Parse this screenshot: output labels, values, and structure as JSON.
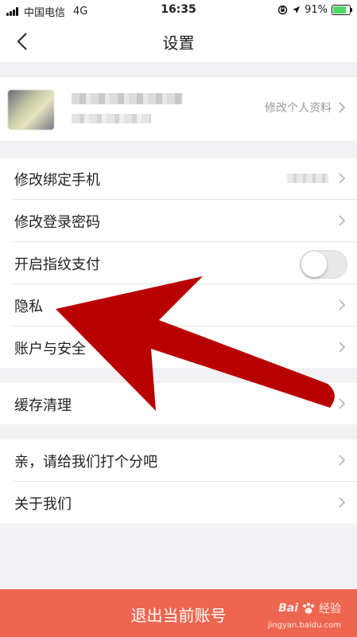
{
  "status_bar": {
    "carrier": "中国电信",
    "network": "4G",
    "time": "16:35",
    "battery": "91%",
    "battery_level": 0.91
  },
  "nav": {
    "title": "设置"
  },
  "profile": {
    "edit_label": "修改个人资料"
  },
  "groups": [
    {
      "items": [
        {
          "label": "修改绑定手机"
        },
        {
          "label": "修改登录密码"
        },
        {
          "label": "开启指纹支付",
          "toggle": false
        },
        {
          "label": "隐私"
        },
        {
          "label": "账户与安全"
        }
      ]
    },
    {
      "items": [
        {
          "label": "缓存清理"
        }
      ]
    },
    {
      "items": [
        {
          "label": "亲，请给我们打个分吧"
        },
        {
          "label": "关于我们"
        }
      ]
    }
  ],
  "logout": {
    "label": "退出当前账号"
  },
  "watermark": {
    "brand": "Bai",
    "brand2": "经验",
    "url": "jingyan.baidu.com"
  },
  "colors": {
    "accent": "#ee6650",
    "arrow": "#b90000",
    "toggle_off": "#e9e9ea"
  }
}
